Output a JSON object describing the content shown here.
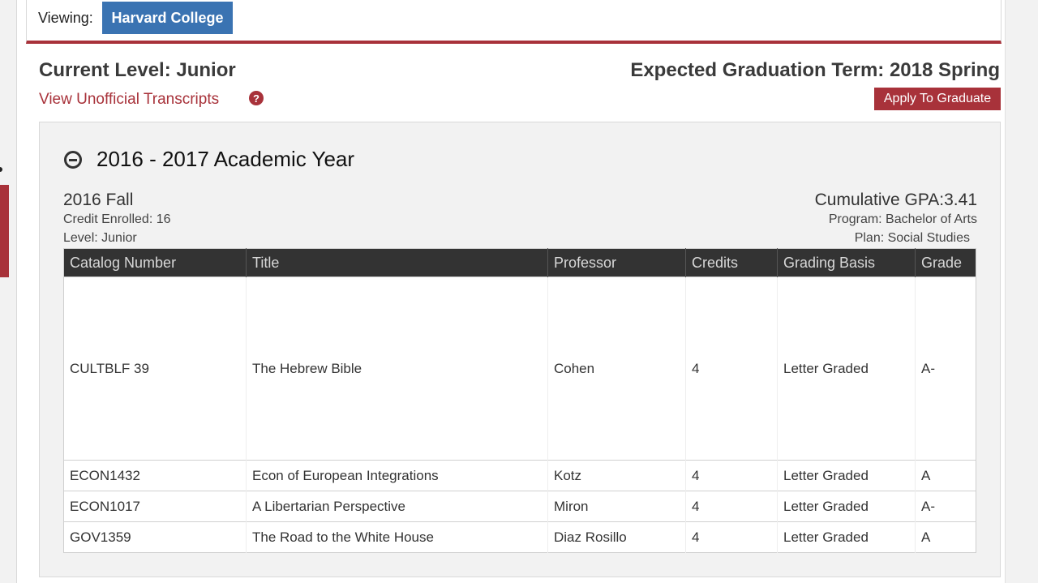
{
  "header": {
    "viewing_label": "Viewing:",
    "viewing_value": "Harvard College"
  },
  "summary": {
    "current_level": "Current Level: Junior",
    "expected_graduation": "Expected Graduation Term: 2018 Spring",
    "transcripts_link": "View Unofficial Transcripts",
    "help_glyph": "?",
    "apply_button": "Apply To Graduate"
  },
  "academic_year": {
    "title": "2016 - 2017 Academic Year",
    "term": {
      "name": "2016 Fall",
      "credit_enrolled": "Credit Enrolled: 16",
      "level": "Level: Junior",
      "cumulative_gpa": "Cumulative GPA:3.41",
      "program": "Program: Bachelor of Arts",
      "plan": "Plan: Social Studies"
    },
    "columns": [
      "Catalog Number",
      "Title",
      "Professor",
      "Credits",
      "Grading Basis",
      "Grade"
    ],
    "courses": [
      {
        "catalog": "CULTBLF 39",
        "title": "The Hebrew Bible",
        "professor": "Cohen",
        "credits": "4",
        "basis": "Letter Graded",
        "grade": "A-"
      },
      {
        "catalog": "ECON1432",
        "title": "Econ of European Integrations",
        "professor": "Kotz",
        "credits": "4",
        "basis": "Letter Graded",
        "grade": "A"
      },
      {
        "catalog": "ECON1017",
        "title": "A Libertarian Perspective",
        "professor": "Miron",
        "credits": "4",
        "basis": "Letter Graded",
        "grade": "A-"
      },
      {
        "catalog": "GOV1359",
        "title": "The Road to the White House",
        "professor": "Diaz Rosillo",
        "credits": "4",
        "basis": "Letter Graded",
        "grade": "A"
      }
    ]
  },
  "colors": {
    "accent_red": "#a8323a",
    "button_blue": "#3a73b2",
    "table_header_bg": "#333333"
  }
}
